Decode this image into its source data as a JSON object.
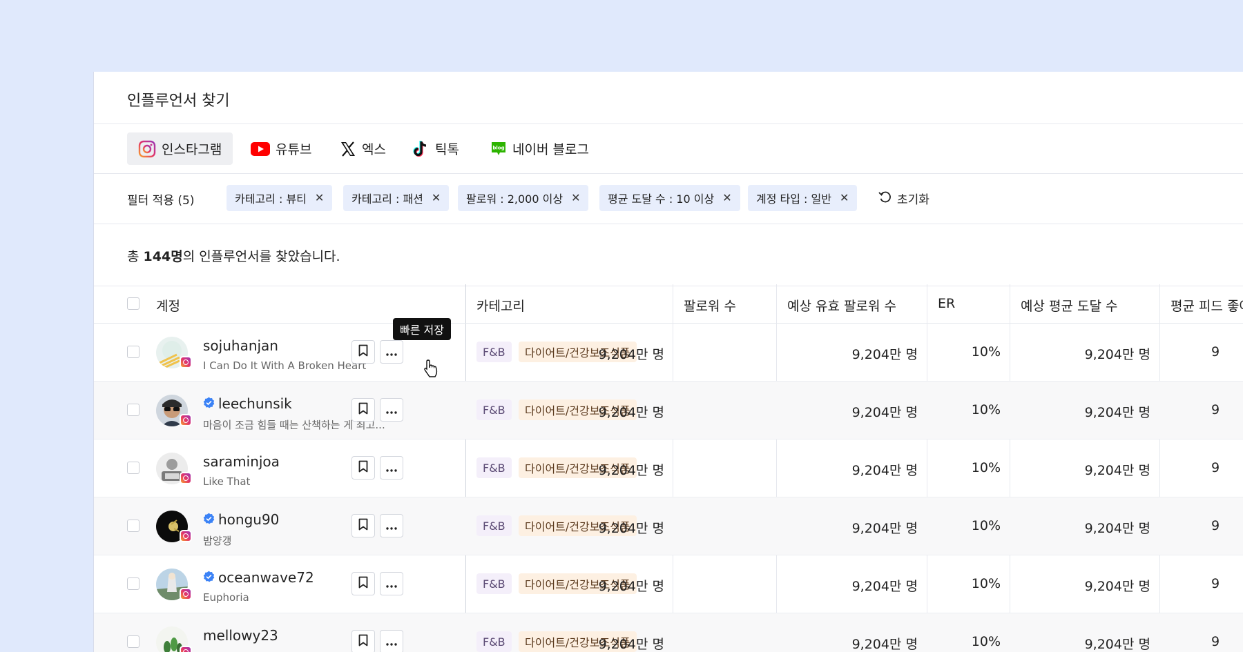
{
  "page": {
    "title": "인플루언서 찾기"
  },
  "tabs": [
    {
      "label": "인스타그램",
      "icon": "instagram-icon",
      "active": true
    },
    {
      "label": "유튜브",
      "icon": "youtube-icon"
    },
    {
      "label": "엑스",
      "icon": "x-icon"
    },
    {
      "label": "틱톡",
      "icon": "tiktok-icon"
    },
    {
      "label": "네이버 블로그",
      "icon": "naver-blog-icon"
    }
  ],
  "filters": {
    "label": "필터 적용 (5)",
    "chips": [
      "카테고리 : 뷰티",
      "카테고리 : 패션",
      "팔로워 : 2,000 이상",
      "평균 도달 수 : 10 이상",
      "계정 타입 : 일반"
    ],
    "reset_label": "초기화"
  },
  "result": {
    "prefix": "총 ",
    "count": "144명",
    "suffix": "의 인플루언서를 찾았습니다."
  },
  "table": {
    "headers": [
      "계정",
      "카테고리",
      "팔로워 수",
      "예상 유효 팔로워 수",
      "ER",
      "예상 평균 도달 수",
      "평균 피드 좋아요"
    ],
    "rows": [
      {
        "username": "sojuhanjan",
        "bio": "I Can Do It With A Broken Heart",
        "verified": false,
        "tags": [
          "F&B",
          "다이어트/건강보조식품"
        ],
        "followers": "9,204만 명",
        "effective": "9,204만 명",
        "er": "10%",
        "reach": "9,204만 명",
        "likes": "9"
      },
      {
        "username": "leechunsik",
        "bio": "마음이 조금 힘들 때는 산책하는 게 최고...",
        "verified": true,
        "tags": [
          "F&B",
          "다이어트/건강보조식품"
        ],
        "followers": "9,204만 명",
        "effective": "9,204만 명",
        "er": "10%",
        "reach": "9,204만 명",
        "likes": "9"
      },
      {
        "username": "saraminjoa",
        "bio": "Like That",
        "verified": false,
        "tags": [
          "F&B",
          "다이어트/건강보조식품"
        ],
        "followers": "9,204만 명",
        "effective": "9,204만 명",
        "er": "10%",
        "reach": "9,204만 명",
        "likes": "9"
      },
      {
        "username": "hongu90",
        "bio": "밤양갱",
        "verified": true,
        "tags": [
          "F&B",
          "다이어트/건강보조식품"
        ],
        "followers": "9,204만 명",
        "effective": "9,204만 명",
        "er": "10%",
        "reach": "9,204만 명",
        "likes": "9"
      },
      {
        "username": "oceanwave72",
        "bio": "Euphoria",
        "verified": true,
        "tags": [
          "F&B",
          "다이어트/건강보조식품"
        ],
        "followers": "9,204만 명",
        "effective": "9,204만 명",
        "er": "10%",
        "reach": "9,204만 명",
        "likes": "9"
      },
      {
        "username": "mellowy23",
        "bio": "",
        "verified": false,
        "tags": [
          "F&B",
          "다이어트/건강보조식품"
        ],
        "followers": "9,204만 명",
        "effective": "9,204만 명",
        "er": "10%",
        "reach": "9,204만 명",
        "likes": "9"
      }
    ]
  },
  "tooltip": {
    "label": "빠른 저장"
  },
  "colors": {
    "background": "#e0e9fc",
    "chip": "#e8eefc",
    "tag_fb": "#f4effa",
    "tag_category": "#fdf0e2",
    "verified": "#3b82f6"
  }
}
